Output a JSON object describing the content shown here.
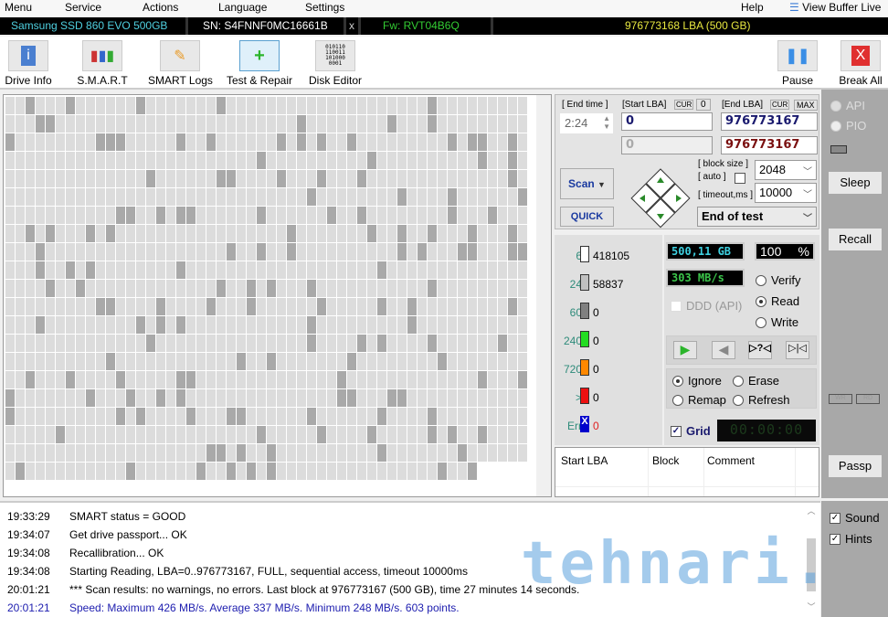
{
  "menu": [
    "Menu",
    "Service",
    "Actions",
    "Language",
    "Settings",
    "Help"
  ],
  "view_buffer": "View Buffer Live",
  "drive": {
    "model": "Samsung SSD 860 EVO 500GB",
    "serial": "SN: S4FNNF0MC16661B",
    "close": "x",
    "firmware": "Fw: RVT04B6Q",
    "lba": "976773168 LBA (500 GB)"
  },
  "toolbar": [
    {
      "label": "Drive Info",
      "icon": "info-icon"
    },
    {
      "label": "S.M.A.R.T",
      "icon": "smart-icon"
    },
    {
      "label": "SMART Logs",
      "icon": "logs-icon"
    },
    {
      "label": "Test & Repair",
      "icon": "first-aid-icon"
    },
    {
      "label": "Disk Editor",
      "icon": "binary-icon"
    }
  ],
  "pause": "Pause",
  "break_all": "Break All",
  "controls": {
    "end_time_label": "[ End time ]",
    "end_time": "2:24",
    "start_lba_label": "[Start LBA]",
    "cur": "CUR",
    "zero": "0",
    "end_lba_label": "[End LBA]",
    "max": "MAX",
    "start_lba": "0",
    "end_lba": "976773167",
    "start_lba2": "0",
    "end_lba2": "976773167",
    "scan": "Scan",
    "quick": "QUICK",
    "block_size_label": "[ block size ]",
    "auto_label": "[ auto ]",
    "timeout_label": "[ timeout,ms ]",
    "block_size": "2048",
    "timeout": "10000",
    "end_action": "End of test"
  },
  "side": {
    "api": "API",
    "pio": "PIO",
    "sleep": "Sleep",
    "recall": "Recall",
    "wr": "WR",
    "rd": "RD",
    "passp": "Passp"
  },
  "stats": [
    {
      "ms": "6",
      "count": "418105",
      "color": "#ffffff"
    },
    {
      "ms": "24",
      "count": "58837",
      "color": "#c0c0c0"
    },
    {
      "ms": "60",
      "count": "0",
      "color": "#808080"
    },
    {
      "ms": "240",
      "count": "0",
      "color": "#22dd22"
    },
    {
      "ms": "720",
      "count": "0",
      "color": "#ff8800"
    },
    {
      "ms": ">",
      "count": "0",
      "color": "#ee1111"
    },
    {
      "ms": "Err",
      "count": "0",
      "color": "#0000cc"
    }
  ],
  "progress": {
    "size": "500,11 GB",
    "percent": "100",
    "percent_sign": "%",
    "speed": "303 MB/s",
    "ddd": "DDD (API)",
    "verify": "Verify",
    "read": "Read",
    "write": "Write",
    "mode": "Read",
    "progress_value": 100
  },
  "repair": {
    "ignore": "Ignore",
    "erase": "Erase",
    "remap": "Remap",
    "refresh": "Refresh",
    "selected": "Ignore"
  },
  "grid_label": "Grid",
  "timer": "00:00:00",
  "table": {
    "columns": [
      "Start LBA",
      "Block",
      "Comment"
    ]
  },
  "log": [
    {
      "time": "19:33:29",
      "text": "SMART status = GOOD"
    },
    {
      "time": "19:34:07",
      "text": "Get drive passport... OK"
    },
    {
      "time": "19:34:08",
      "text": "Recallibration... OK"
    },
    {
      "time": "19:34:08",
      "text": "Starting Reading, LBA=0..976773167, FULL, sequential access, timeout 10000ms"
    },
    {
      "time": "20:01:21",
      "text": "*** Scan results: no warnings, no errors. Last block at 976773167 (500 GB), time 27 minutes 14 seconds."
    },
    {
      "time": "20:01:21",
      "text": "Speed: Maximum 426 MB/s. Average 337 MB/s. Minimum 248 MB/s. 603 points."
    }
  ],
  "options": {
    "sound": "Sound",
    "hints": "Hints"
  }
}
